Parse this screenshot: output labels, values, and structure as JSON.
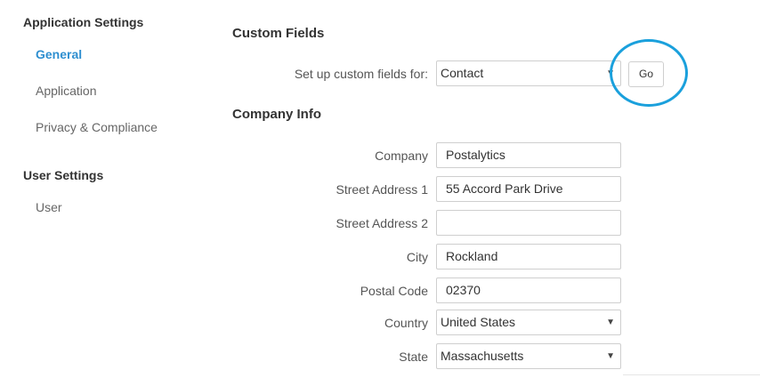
{
  "sidebar": {
    "application_heading": "Application Settings",
    "application_items": [
      {
        "label": "General"
      },
      {
        "label": "Application"
      },
      {
        "label": "Privacy & Compliance"
      }
    ],
    "user_heading": "User Settings",
    "user_items": [
      {
        "label": "User"
      }
    ]
  },
  "custom_fields": {
    "title": "Custom Fields",
    "label": "Set up custom fields for:",
    "selected": "Contact",
    "go_label": "Go"
  },
  "company_info": {
    "title": "Company Info",
    "fields": {
      "company": {
        "label": "Company",
        "value": "Postalytics"
      },
      "street1": {
        "label": "Street Address 1",
        "value": "55 Accord Park Drive"
      },
      "street2": {
        "label": "Street Address 2",
        "value": ""
      },
      "city": {
        "label": "City",
        "value": "Rockland"
      },
      "postal": {
        "label": "Postal Code",
        "value": "02370"
      },
      "country": {
        "label": "Country",
        "value": "United States"
      },
      "state": {
        "label": "State",
        "value": "Massachusetts"
      }
    }
  },
  "colors": {
    "active_nav": "#2f8fd0",
    "highlight_ring": "#1aa0dc"
  }
}
